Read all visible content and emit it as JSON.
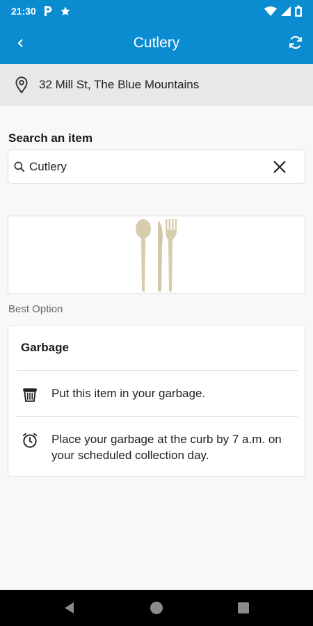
{
  "status": {
    "time": "21:30",
    "icons": [
      "parking-icon",
      "star-icon",
      "wifi-icon",
      "signal-icon",
      "battery-icon"
    ]
  },
  "header": {
    "title": "Cutlery"
  },
  "address": {
    "text": "32 Mill St, The Blue Mountains"
  },
  "search": {
    "label": "Search an item",
    "value": "Cutlery"
  },
  "best_option": {
    "label": "Best Option"
  },
  "option": {
    "title": "Garbage",
    "rows": [
      {
        "icon": "garbage-bin-icon",
        "text": "Put this item in your garbage."
      },
      {
        "icon": "alarm-clock-icon",
        "text": "Place your garbage at the curb by 7 a.m. on your scheduled collection day."
      }
    ]
  },
  "colors": {
    "brand": "#0b8bd0",
    "background": "#f9f8f8",
    "address_bar": "#e8e8e8",
    "cutlery": "#d8ccae"
  }
}
